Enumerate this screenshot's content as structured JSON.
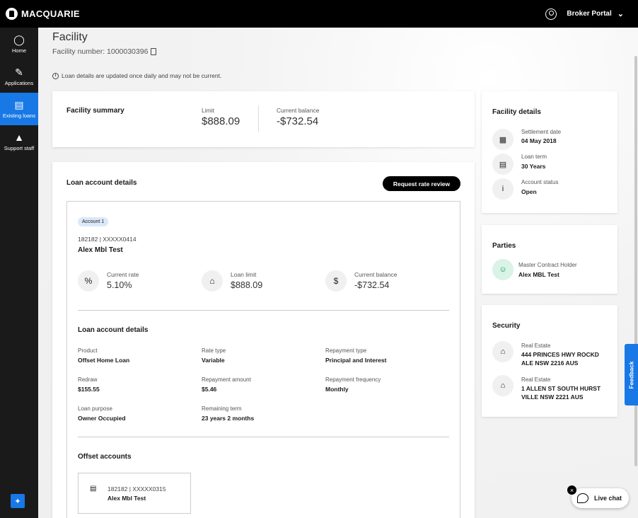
{
  "header": {
    "brand": "MACQUARIE",
    "portal_label": "Broker Portal"
  },
  "sidebar": {
    "items": [
      {
        "label": "Home",
        "icon": "dashboard-icon"
      },
      {
        "label": "Applications",
        "icon": "applications-icon"
      },
      {
        "label": "Existing loans",
        "icon": "existing-loans-icon"
      },
      {
        "label": "Support staff",
        "icon": "org-chart-icon"
      }
    ]
  },
  "page": {
    "title": "Facility",
    "facility_number": "Facility number: 1000030396",
    "notice": "Loan details are updated once daily and may not be current."
  },
  "summary": {
    "title": "Facility summary",
    "limit_label": "Limit",
    "limit_value": "$888.09",
    "balance_label": "Current balance",
    "balance_value": "-$732.54"
  },
  "loan": {
    "title": "Loan account details",
    "request_button": "Request rate review",
    "account_badge": "Account 1",
    "account_number": "182182 | XXXXX0414",
    "account_name": "Alex Mbl Test",
    "metrics": [
      {
        "label": "Current rate",
        "value": "5.10%",
        "icon": "percent-icon"
      },
      {
        "label": "Loan limit",
        "value": "$888.09",
        "icon": "house-limit-icon"
      },
      {
        "label": "Current balance",
        "value": "-$732.54",
        "icon": "dollar-icon"
      }
    ],
    "details_title": "Loan account details",
    "details": {
      "product_label": "Product",
      "product_value": "Offset Home Loan",
      "rate_type_label": "Rate type",
      "rate_type_value": "Variable",
      "repayment_type_label": "Repayment type",
      "repayment_type_value": "Principal and Interest",
      "redraw_label": "Redraw",
      "redraw_value": "$155.55",
      "repayment_amount_label": "Repayment amount",
      "repayment_amount_value": "$5.46",
      "repayment_frequency_label": "Repayment frequency",
      "repayment_frequency_value": "Monthly",
      "loan_purpose_label": "Loan purpose",
      "loan_purpose_value": "Owner Occupied",
      "remaining_term_label": "Remaining term",
      "remaining_term_value": "23 years 2 months"
    },
    "offset_title": "Offset accounts",
    "offset": {
      "number": "182182 | XXXXX0315",
      "name": "Alex Mbl Test"
    }
  },
  "facility_details": {
    "title": "Facility details",
    "settlement_label": "Settlement date",
    "settlement_value": "04 May 2018",
    "term_label": "Loan term",
    "term_value": "30 Years",
    "status_label": "Account status",
    "status_value": "Open"
  },
  "parties": {
    "title": "Parties",
    "role": "Master Contract Holder",
    "name": "Alex MBL Test"
  },
  "security": {
    "title": "Security",
    "items": [
      {
        "type": "Real Estate",
        "address": "444 PRINCES HWY ROCKD ALE NSW 2216 AUS"
      },
      {
        "type": "Real Estate",
        "address": "1 ALLEN ST SOUTH HURST VILLE NSW 2221 AUS"
      }
    ]
  },
  "widgets": {
    "feedback": "Feedback",
    "live_chat": "Live chat"
  },
  "colors": {
    "accent": "#1778e6",
    "topbar": "#000000",
    "sidebar": "#1a1a1a"
  }
}
